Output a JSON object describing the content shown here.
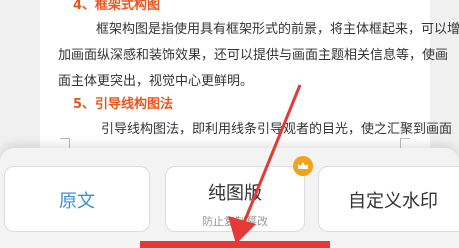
{
  "document": {
    "lines": [
      "4、框架式构图",
      "框架构图是指使用具有框架形式的前景，将主体框起来，可以增",
      "加画面纵深感和装饰效果，还可以提供与画面主题相关信息等，使画",
      "面主体更突出，视觉中心更鲜明。",
      "5、引导线构图法",
      "引导线构图法，即利用线条引导观者的目光，使之汇聚到画面"
    ]
  },
  "options": {
    "original_label": "原文",
    "plain_label": "纯图版",
    "plain_sub": "防止复制篡改",
    "custom_watermark_label": "自定义水印"
  },
  "colors": {
    "heading": "#e8551f",
    "accent": "#3b8fd6",
    "vip": "#f4a11c",
    "annotation": "#e53935"
  },
  "icons": {
    "vip_badge": "crown-icon"
  }
}
